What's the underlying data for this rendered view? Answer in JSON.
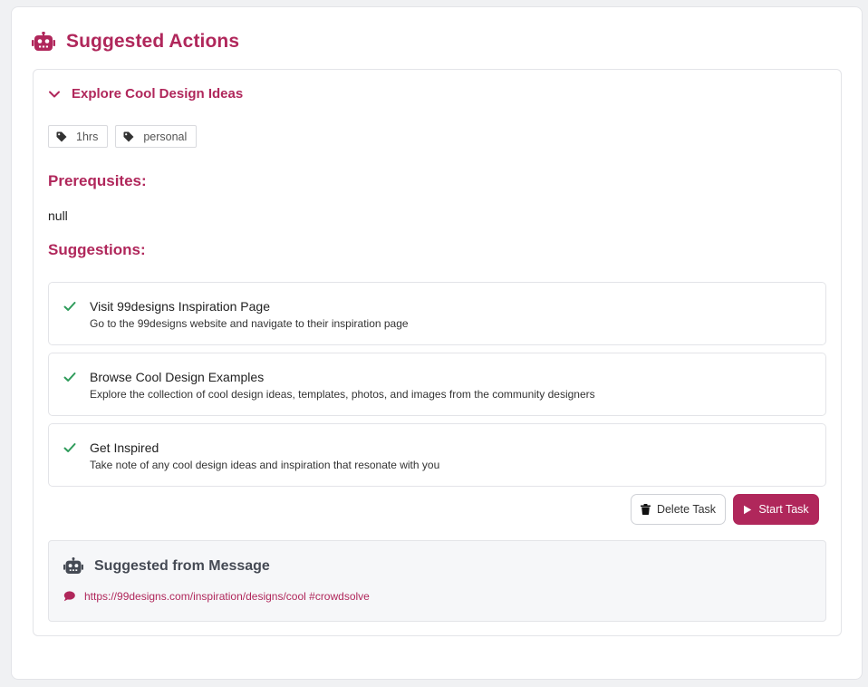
{
  "header": {
    "title": "Suggested Actions",
    "icon": "robot-icon"
  },
  "task": {
    "title": "Explore Cool Design Ideas",
    "tags": [
      {
        "label": "1hrs",
        "icon": "tag-icon"
      },
      {
        "label": "personal",
        "icon": "tag-icon"
      }
    ],
    "prerequisites_label": "Prerequsites:",
    "prerequisites_value": "null",
    "suggestions_label": "Suggestions:",
    "suggestions": [
      {
        "title": "Visit 99designs Inspiration Page",
        "description": "Go to the 99designs website and navigate to their inspiration page"
      },
      {
        "title": "Browse Cool Design Examples",
        "description": "Explore the collection of cool design ideas, templates, photos, and images from the community designers"
      },
      {
        "title": "Get Inspired",
        "description": "Take note of any cool design ideas and inspiration that resonate with you"
      }
    ],
    "delete_label": "Delete Task",
    "start_label": "Start Task"
  },
  "message": {
    "title": "Suggested from Message",
    "link_text": "https://99designs.com/inspiration/designs/cool #crowdsolve"
  },
  "colors": {
    "accent": "#b0275b",
    "check": "#2e9b5a",
    "muted_heading": "#454a54"
  }
}
